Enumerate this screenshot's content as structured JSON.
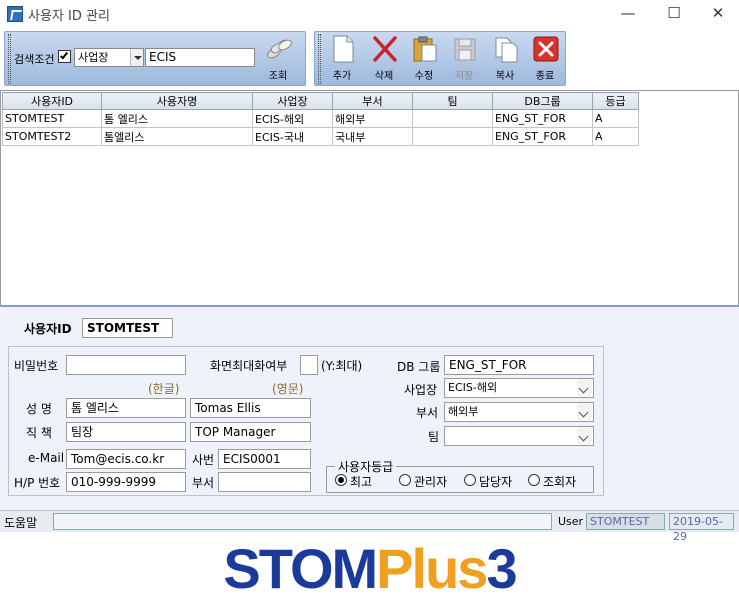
{
  "window": {
    "title": "사용자 ID 관리",
    "minimize": "—",
    "maximize": "☐",
    "close": "✕"
  },
  "toolbar": {
    "search_label": "검색조건",
    "search_checked": true,
    "search_field": "사업장",
    "search_value": "ECIS",
    "query_label": "조회",
    "add_label": "추가",
    "delete_label": "삭제",
    "edit_label": "수정",
    "save_label": "저장",
    "copy_label": "복사",
    "exit_label": "종료"
  },
  "grid": {
    "headers": [
      "사용자ID",
      "사용자명",
      "사업장",
      "부서",
      "팀",
      "DB그룹",
      "등급"
    ],
    "rows": [
      [
        "STOMTEST",
        "톰 엘리스",
        "ECIS-해외",
        "해외부",
        "",
        "ENG_ST_FOR",
        "A"
      ],
      [
        "STOMTEST2",
        "톰엘리스",
        "ECIS-국내",
        "국내부",
        "",
        "ENG_ST_FOR",
        "A"
      ]
    ]
  },
  "detail": {
    "user_id_label": "사용자ID",
    "user_id_value": "STOMTEST",
    "password_label": "비밀번호",
    "password_value": "",
    "maximize_label": "화면최대화여부",
    "maximize_value": "",
    "maximize_hint": "(Y:최대)",
    "hangul_label": "(한글)",
    "english_label": "(영문)",
    "name_label": "성  명",
    "name_ko": "톰 엘리스",
    "name_en": "Tomas Ellis",
    "position_label": "직  책",
    "position_ko": "팀장",
    "position_en": "TOP Manager",
    "email_label": "e-Mail",
    "email_value": "Tom@ecis.co.kr",
    "emp_no_label": "사번",
    "emp_no_value": "ECIS0001",
    "phone_label": "H/P 번호",
    "phone_value": "010-999-9999",
    "dept_label_left": "부서",
    "dept_value_left": "",
    "db_group_label": "DB 그룹",
    "db_group_value": "ENG_ST_FOR",
    "site_label": "사업장",
    "site_value": "ECIS-해외",
    "dept_label": "부서",
    "dept_value": "해외부",
    "team_label": "팀",
    "team_value": "",
    "grade_group_label": "사용자등급",
    "grades": [
      "최고",
      "관리자",
      "담당자",
      "조회자"
    ],
    "grade_selected": "최고"
  },
  "status": {
    "help_label": "도움말",
    "help_text": "",
    "user_label": "User",
    "user_value": "STOMTEST",
    "date_value": "2019-05-29"
  },
  "logo": {
    "part1": "STOM",
    "part2": "Plus",
    "part3": "3",
    "color1": "#1b3a9a",
    "color2": "#f0a020"
  }
}
